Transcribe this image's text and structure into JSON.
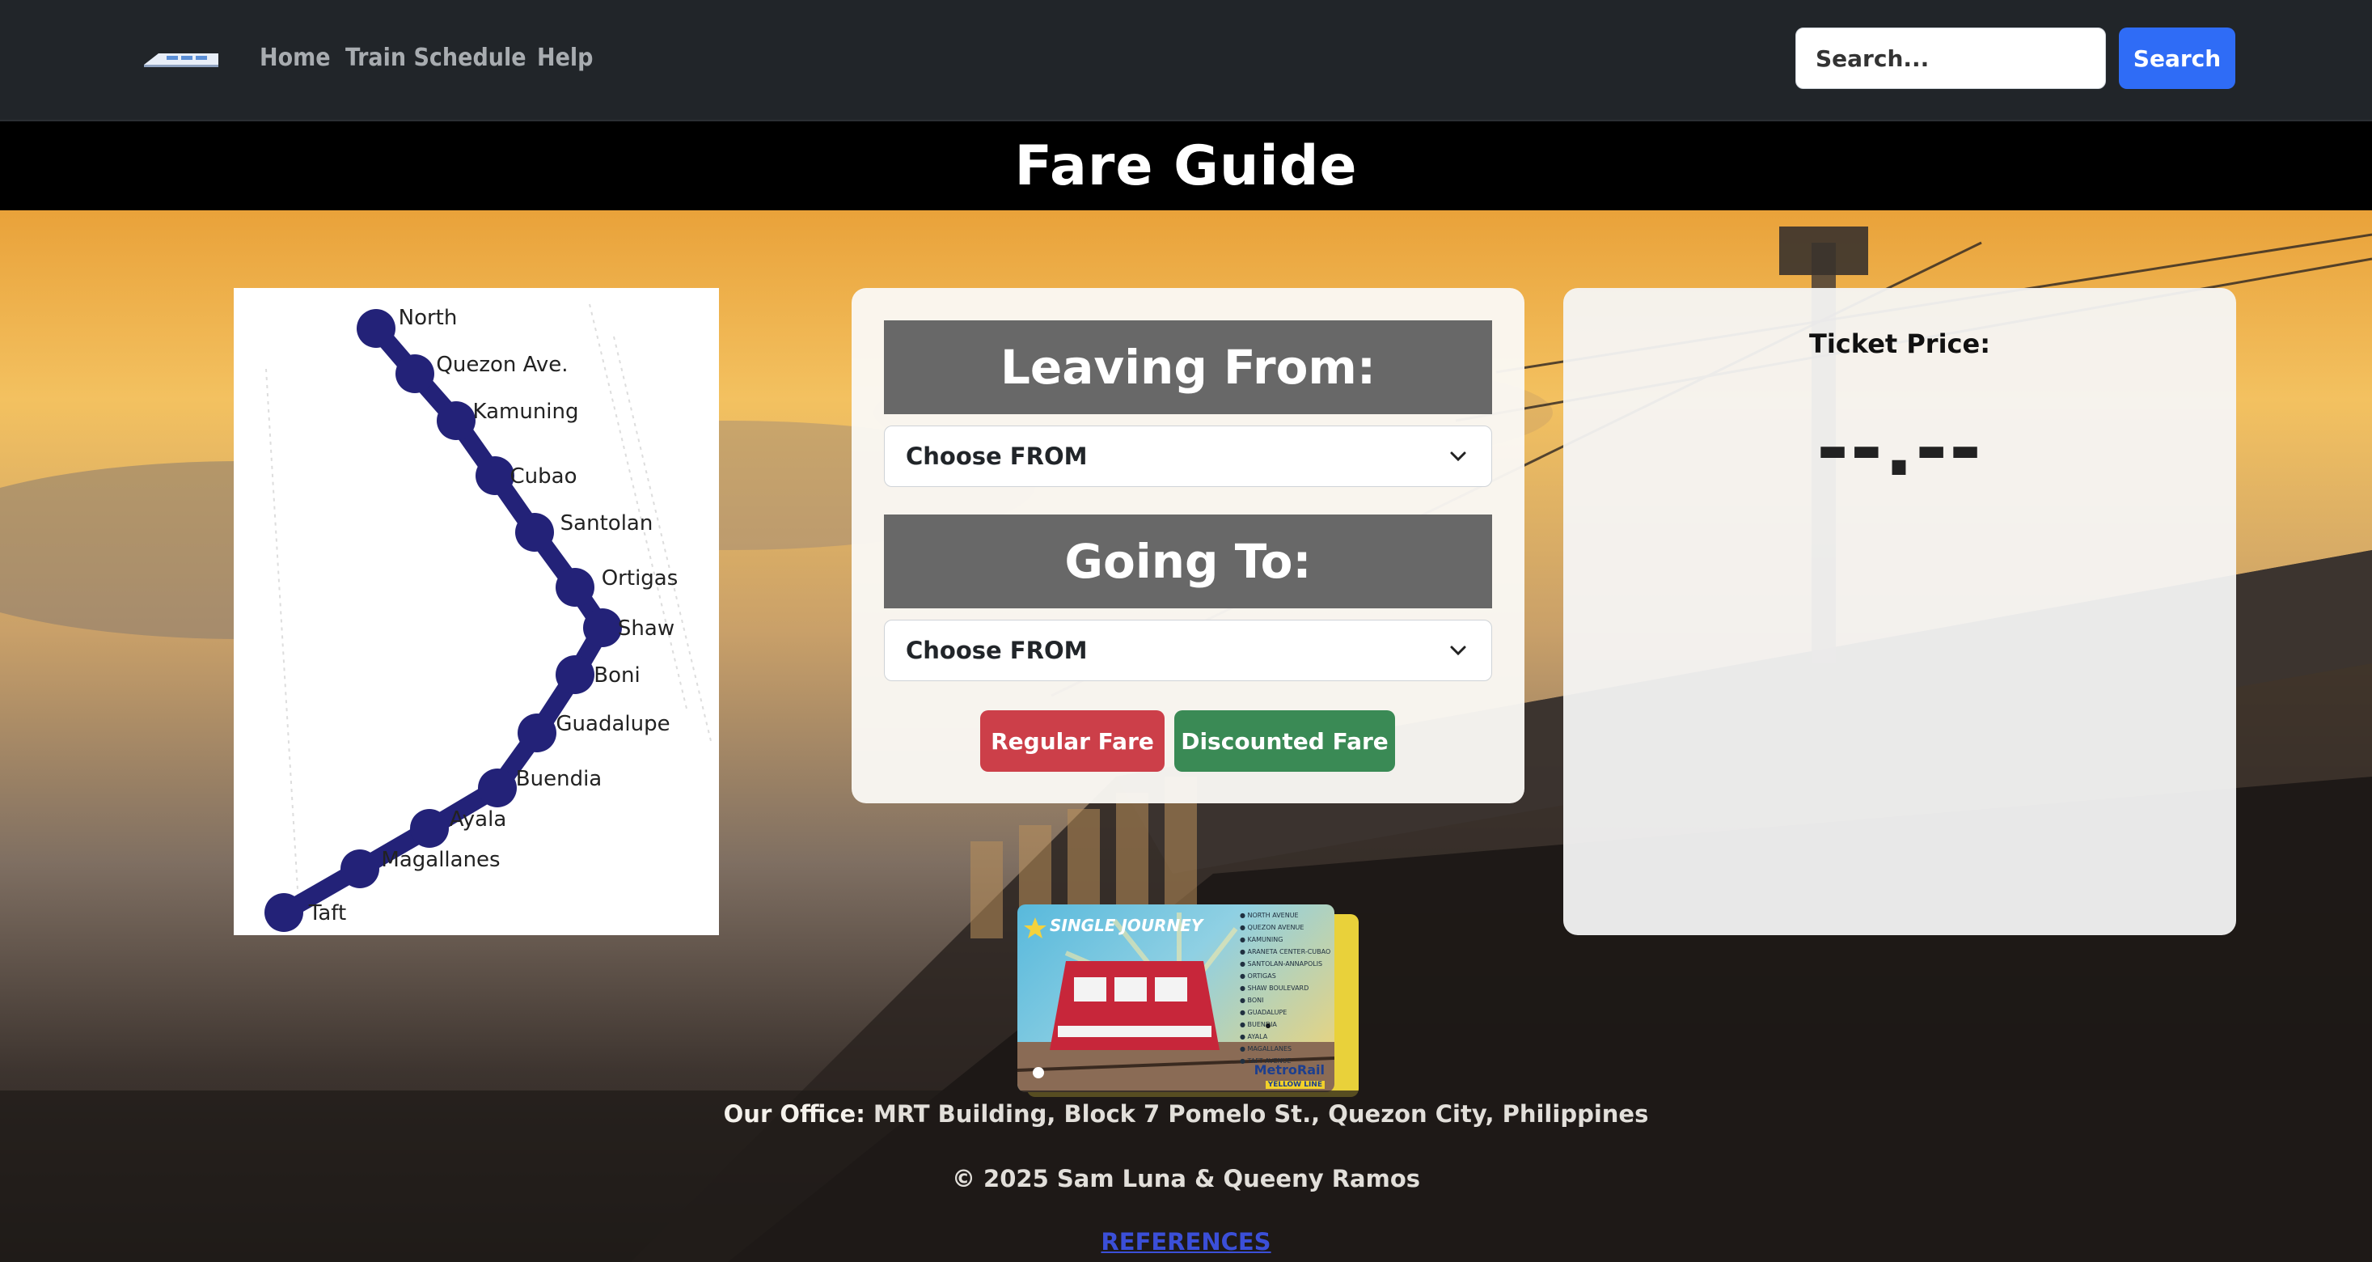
{
  "nav": {
    "links": [
      "Home",
      "Train Schedule",
      "Help"
    ],
    "search_placeholder": "Search...",
    "search_button": "Search"
  },
  "page_title": "Fare Guide",
  "map": {
    "stations": [
      "North",
      "Quezon Ave.",
      "Kamuning",
      "Cubao",
      "Santolan",
      "Ortigas",
      "Shaw",
      "Boni",
      "Guadalupe",
      "Buendia",
      "Ayala",
      "Magallanes",
      "Taft"
    ],
    "line_color": "#232278"
  },
  "form": {
    "leaving_header": "Leaving From:",
    "leaving_selected": "Choose FROM",
    "going_header": "Going To:",
    "going_selected": "Choose FROM",
    "regular_button": "Regular Fare",
    "discounted_button": "Discounted Fare"
  },
  "price": {
    "label": "Ticket Price:",
    "value": "--.--"
  },
  "ticket": {
    "title": "SINGLE JOURNEY",
    "stations": [
      "NORTH AVENUE",
      "QUEZON AVENUE",
      "KAMUNING",
      "ARANETA CENTER-CUBAO",
      "SANTOLAN-ANNAPOLIS",
      "ORTIGAS",
      "SHAW BOULEVARD",
      "BONI",
      "GUADALUPE",
      "BUENDIA",
      "AYALA",
      "MAGALLANES",
      "TAFT AVENUE"
    ],
    "brand": "MetroRail",
    "subbrand": "YELLOW LINE"
  },
  "footer": {
    "office_label": "Our Office:",
    "office_address": "MRT Building, Block 7 Pomelo St., Quezon City, Philippines",
    "copyright": "© 2025 Sam Luna & Queeny Ramos",
    "references_link": "REFERENCES"
  },
  "colors": {
    "navbar": "#212529",
    "search_button": "#2f6cf6",
    "header_box": "#686868",
    "regular_fare": "#cc3f49",
    "discounted_fare": "#3a8a55"
  }
}
